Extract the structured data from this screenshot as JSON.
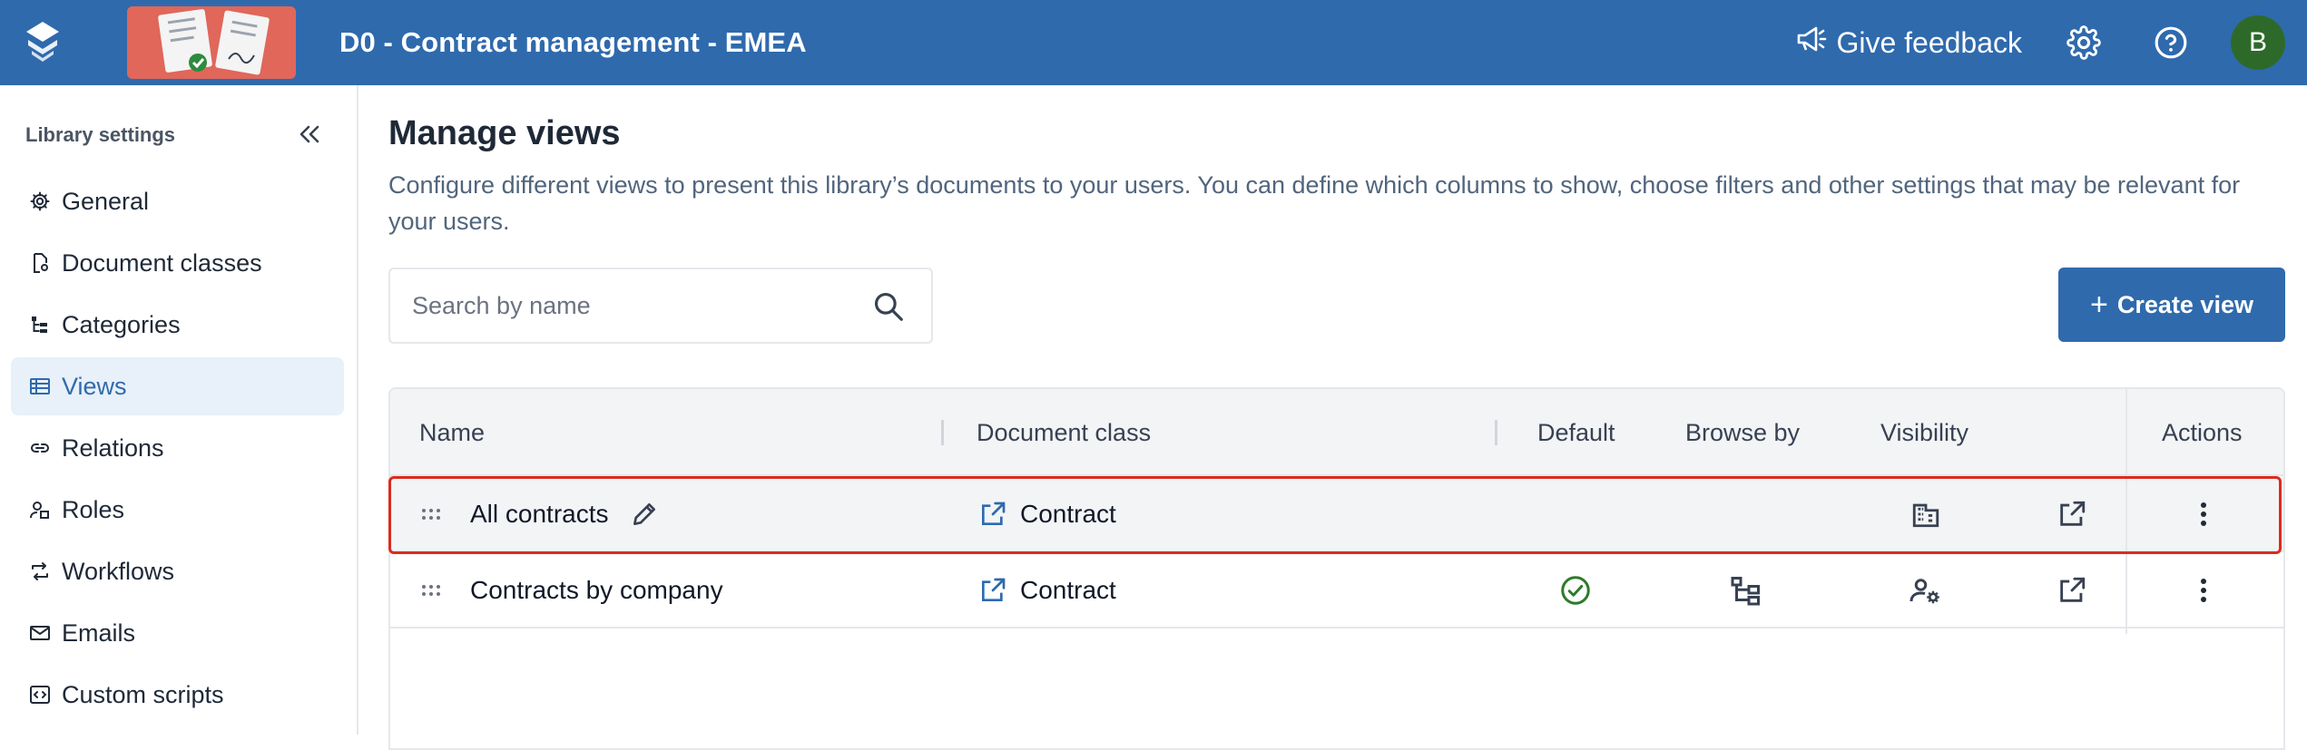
{
  "header": {
    "title": "D0 - Contract management - EMEA",
    "feedback_label": "Give feedback",
    "avatar_initial": "B"
  },
  "sidebar": {
    "title": "Library settings",
    "items": [
      {
        "label": "General",
        "icon": "gear-icon",
        "active": false
      },
      {
        "label": "Document classes",
        "icon": "document-class-icon",
        "active": false
      },
      {
        "label": "Categories",
        "icon": "categories-icon",
        "active": false
      },
      {
        "label": "Views",
        "icon": "views-icon",
        "active": true
      },
      {
        "label": "Relations",
        "icon": "link-icon",
        "active": false
      },
      {
        "label": "Roles",
        "icon": "roles-icon",
        "active": false
      },
      {
        "label": "Workflows",
        "icon": "workflow-icon",
        "active": false
      },
      {
        "label": "Emails",
        "icon": "mail-icon",
        "active": false
      },
      {
        "label": "Custom scripts",
        "icon": "code-icon",
        "active": false
      }
    ]
  },
  "main": {
    "title": "Manage views",
    "description": "Configure different views to present this library’s documents to your users. You can define which columns to show, choose filters and other settings that may be relevant for your users.",
    "search": {
      "placeholder": "Search by name",
      "value": ""
    },
    "create_label": "Create view",
    "table": {
      "columns": [
        "Name",
        "Document class",
        "Default",
        "Browse by",
        "Visibility",
        "Actions"
      ],
      "rows": [
        {
          "name": "All contracts",
          "document_class": "Contract",
          "default": false,
          "browse_by": "",
          "visibility": "organization-icon"
        },
        {
          "name": "Contracts by company",
          "document_class": "Contract",
          "default": true,
          "browse_by": "hierarchy-icon",
          "visibility": "user-settings-icon"
        }
      ]
    }
  },
  "colors": {
    "primary": "#2f6aad",
    "highlight": "#dc2b1f",
    "success": "#2d7a2a",
    "avatar": "#2d6a2a"
  }
}
